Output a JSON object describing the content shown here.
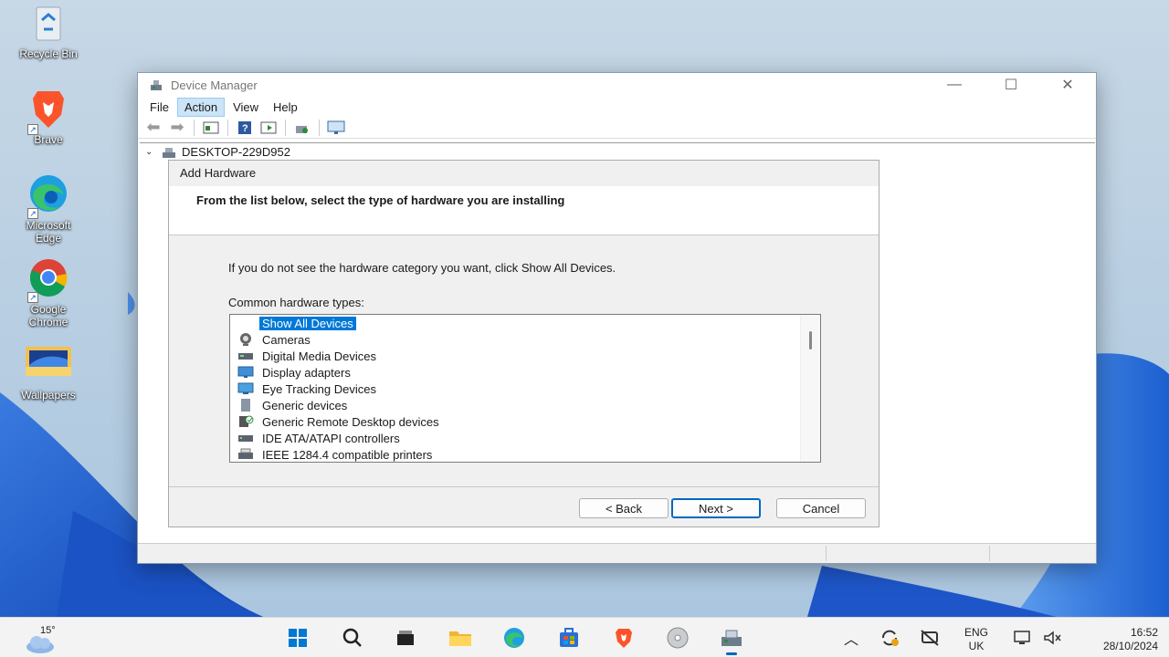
{
  "desktop": {
    "icons": [
      {
        "label": "Recycle Bin"
      },
      {
        "label": "Brave"
      },
      {
        "label": "Microsoft Edge"
      },
      {
        "label": "Google Chrome"
      },
      {
        "label": "Wallpapers"
      }
    ]
  },
  "window": {
    "title": "Device Manager",
    "menu": [
      "File",
      "Action",
      "View",
      "Help"
    ],
    "active_menu": "Action",
    "tree_root": "DESKTOP-229D952"
  },
  "dialog": {
    "title": "Add Hardware",
    "heading": "From the list below, select the type of hardware you are installing",
    "hint": "If you do not see the hardware category you want, click Show All Devices.",
    "list_label": "Common hardware types:",
    "items": [
      {
        "label": "Show All Devices",
        "icon": "none",
        "selected": true
      },
      {
        "label": "Cameras",
        "icon": "camera-icon"
      },
      {
        "label": "Digital Media Devices",
        "icon": "media-device-icon"
      },
      {
        "label": "Display adapters",
        "icon": "display-adapter-icon"
      },
      {
        "label": "Eye Tracking Devices",
        "icon": "eye-tracking-icon"
      },
      {
        "label": "Generic devices",
        "icon": "generic-device-icon"
      },
      {
        "label": "Generic Remote Desktop devices",
        "icon": "remote-desktop-icon"
      },
      {
        "label": "IDE ATA/ATAPI controllers",
        "icon": "ide-controller-icon"
      },
      {
        "label": "IEEE 1284.4 compatible printers",
        "icon": "printer-icon"
      }
    ],
    "buttons": {
      "back": "< Back",
      "next": "Next >",
      "cancel": "Cancel"
    }
  },
  "taskbar": {
    "weather_temp": "15°",
    "language_1": "ENG",
    "language_2": "UK",
    "time": "16:52",
    "date": "28/10/2024"
  },
  "colors": {
    "accent": "#0078d7",
    "selection": "#0078d7"
  }
}
